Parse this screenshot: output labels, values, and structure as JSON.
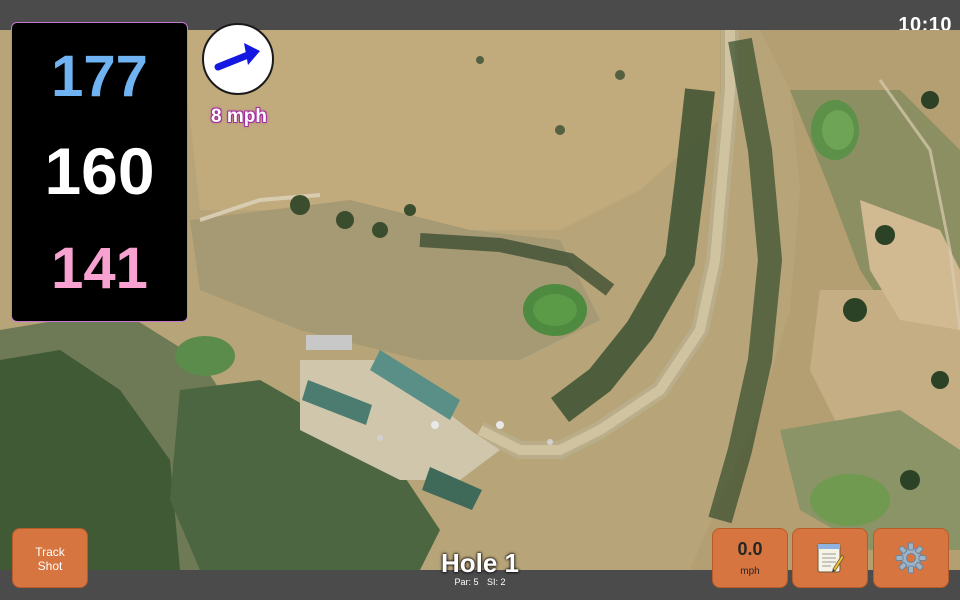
{
  "status_bar": {
    "time": "10:10"
  },
  "yardage": {
    "back": "177",
    "center": "160",
    "front": "141"
  },
  "wind": {
    "speed_label": "8 mph",
    "direction_icon": "arrow-icon"
  },
  "hole": {
    "title": "Hole 1",
    "par_label": "Par: 5",
    "si_label": "SI: 2"
  },
  "buttons": {
    "track_shot_line1": "Track",
    "track_shot_line2": "Shot",
    "speed_value": "0.0",
    "speed_unit": "mph",
    "notes_icon": "notepad-icon",
    "settings_icon": "gear-icon"
  },
  "colors": {
    "back_yardage": "#6fb3f2",
    "center_yardage": "#ffffff",
    "front_yardage": "#f7a2d0",
    "button_bg": "#d6753f",
    "wind_text_outline": "#a52fa0"
  }
}
